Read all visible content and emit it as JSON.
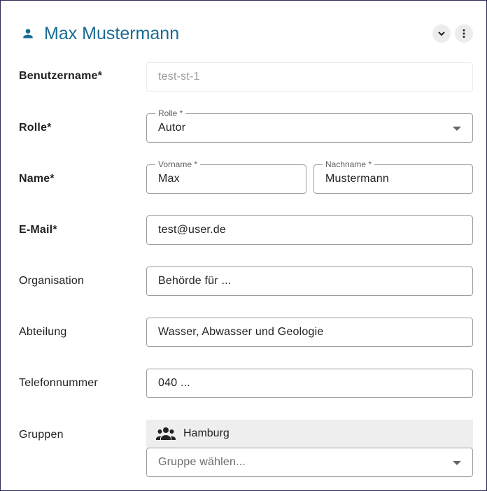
{
  "header": {
    "title": "Max Mustermann",
    "person_icon": "person-icon",
    "collapse_icon": "chevron-down-icon",
    "more_icon": "more-vert-icon",
    "title_color": "#1a6b94"
  },
  "form": {
    "username": {
      "label": "Benutzername*",
      "value": "test-st-1"
    },
    "role": {
      "label": "Rolle*",
      "field_label": "Rolle *",
      "value": "Autor"
    },
    "name": {
      "label": "Name*",
      "firstname_label": "Vorname *",
      "firstname_value": "Max",
      "lastname_label": "Nachname *",
      "lastname_value": "Mustermann"
    },
    "email": {
      "label": "E-Mail*",
      "value": "test@user.de"
    },
    "organisation": {
      "label": "Organisation",
      "value": "Behörde für ..."
    },
    "department": {
      "label": "Abteilung",
      "value": "Wasser, Abwasser und Geologie"
    },
    "phone": {
      "label": "Telefonnummer",
      "value": "040 ..."
    },
    "groups": {
      "label": "Gruppen",
      "chips": [
        {
          "icon": "group-icon",
          "label": "Hamburg"
        }
      ],
      "select_placeholder": "Gruppe wählen..."
    }
  }
}
